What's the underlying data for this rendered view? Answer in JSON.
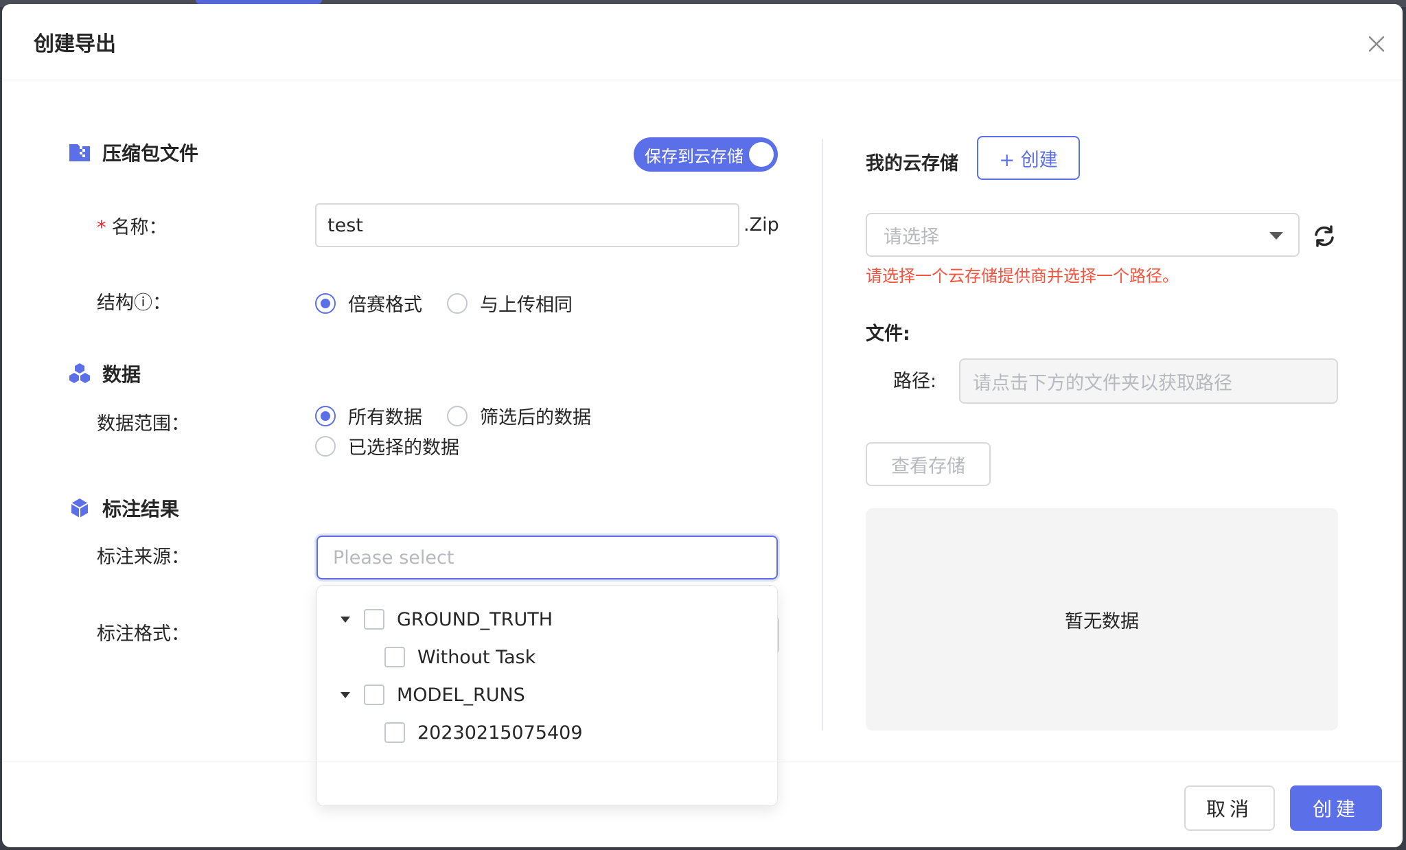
{
  "modal": {
    "title": "创建导出"
  },
  "archive": {
    "section_title": "压缩包文件",
    "save_toggle_label": "保存到云存储",
    "save_toggle_on": true,
    "name_label": "名称：",
    "name_value": "test",
    "name_suffix": ".Zip",
    "structure_label": "结构ⓘ：",
    "structure_options": [
      "倍赛格式",
      "与上传相同"
    ],
    "structure_selected": "倍赛格式"
  },
  "data_section": {
    "section_title": "数据",
    "range_label": "数据范围：",
    "range_options": [
      "所有数据",
      "筛选后的数据",
      "已选择的数据"
    ],
    "range_selected": "所有数据"
  },
  "annotation": {
    "section_title": "标注结果",
    "source_label": "标注来源：",
    "source_placeholder": "Please select",
    "format_label": "标注格式：",
    "tree": [
      {
        "label": "GROUND_TRUTH",
        "children": [
          "Without Task"
        ]
      },
      {
        "label": "MODEL_RUNS",
        "children": [
          "20230215075409"
        ]
      }
    ]
  },
  "cloud": {
    "title": "我的云存储",
    "create_label": "+ 创建",
    "select_placeholder": "请选择",
    "error": "请选择一个云存储提供商并选择一个路径。",
    "file_label": "文件:",
    "path_label": "路径:",
    "path_placeholder": "请点击下方的文件夹以获取路径",
    "view_storage_label": "查看存储",
    "empty_text": "暂无数据"
  },
  "footer": {
    "cancel_label": "取消",
    "create_label": "创建"
  },
  "colors": {
    "accent": "#5b6fe8",
    "error": "#f5533d"
  }
}
